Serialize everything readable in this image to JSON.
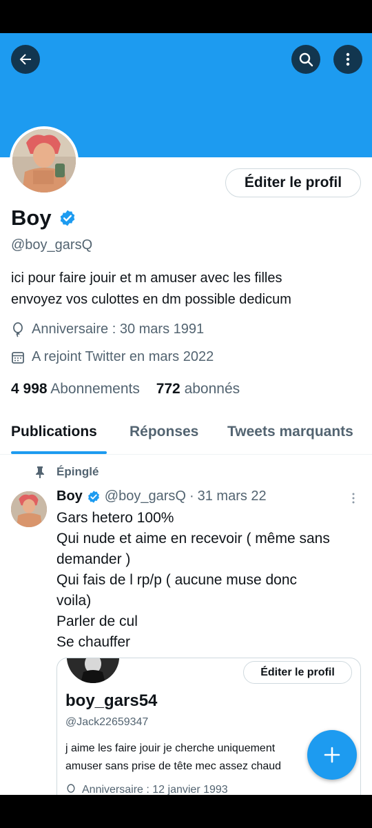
{
  "profile": {
    "edit_button": "Éditer le profil",
    "name": "Boy",
    "handle": "@boy_garsQ",
    "bio_line1": "ici pour faire jouir et m amuser avec les filles",
    "bio_line2": "envoyez vos culottes en dm possible dedicum",
    "birthday": "Anniversaire : 30 mars 1991",
    "joined": "A rejoint Twitter en mars 2022",
    "following_count": "4 998",
    "following_label": "Abonnements",
    "followers_count": "772",
    "followers_label": "abonnés"
  },
  "tabs": [
    "Publications",
    "Réponses",
    "Tweets marquants"
  ],
  "pinned_tweet": {
    "pinned_label": "Épinglé",
    "author_name": "Boy",
    "author_handle": "@boy_garsQ",
    "separator": "·",
    "date": "31 mars 22",
    "lines": [
      "Gars hetero 100%",
      "Qui nude et aime en recevoir ( même sans",
      "demander )",
      "Qui fais de l rp/p ( aucune muse donc",
      "voila)",
      "Parler de cul",
      "Se chauffer"
    ],
    "embed": {
      "edit_button": "Éditer le profil",
      "name": "boy_gars54",
      "handle": "@Jack22659347",
      "bio_line1": "j aime les faire jouir je cherche uniquement",
      "bio_line2": "amuser sans prise de tête mec assez chaud",
      "birthday": "Anniversaire : 12 janvier 1993"
    }
  },
  "icons": {
    "back": "arrow-left-icon",
    "search": "search-icon",
    "more": "more-vertical-icon",
    "verified": "verified-badge-icon",
    "location": "balloon-icon",
    "calendar": "calendar-icon",
    "pin": "pin-icon",
    "compose": "plus-icon"
  },
  "colors": {
    "accent": "#1d9bf0",
    "text": "#0f1419",
    "secondary": "#536471"
  }
}
